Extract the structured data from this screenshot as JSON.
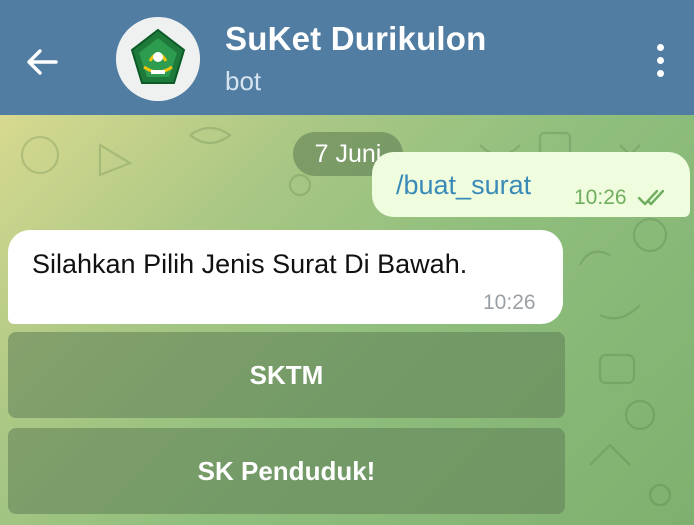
{
  "header": {
    "title": "SuKet Durikulon",
    "subtitle": "bot",
    "background_color": "#527da3"
  },
  "chat": {
    "date_chip": "7 Juni",
    "outgoing_message": {
      "text": "/buat_surat",
      "time": "10:26",
      "status_icon": "double-check-icon"
    },
    "incoming_message": {
      "text": "Silahkan Pilih Jenis Surat Di Bawah.",
      "time": "10:26"
    },
    "keyboard_buttons": [
      {
        "label": "SKTM"
      },
      {
        "label": "SK Penduduk!"
      }
    ]
  },
  "colors": {
    "outgoing_bubble": "#effdde",
    "incoming_bubble": "#ffffff",
    "command_link": "#3a8ab8"
  }
}
